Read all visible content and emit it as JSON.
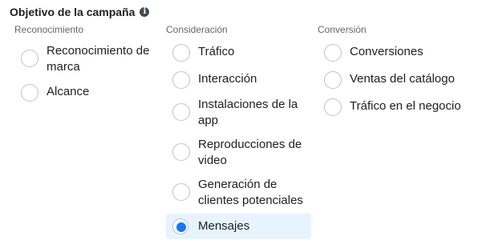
{
  "title": "Objetivo de la campaña",
  "info_icon_glyph": "i",
  "columns": [
    {
      "header": "Reconocimiento",
      "options": [
        {
          "label_line1": "Reconocimiento de",
          "label_line2": "marca"
        },
        {
          "label_line1": "Alcance",
          "label_line2": ""
        }
      ]
    },
    {
      "header": "Consideración",
      "options": [
        {
          "label_line1": "Tráfico",
          "label_line2": ""
        },
        {
          "label_line1": "Interacción",
          "label_line2": ""
        },
        {
          "label_line1": "Instalaciones de la",
          "label_line2": "app"
        },
        {
          "label_line1": "Reproducciones de",
          "label_line2": "video"
        },
        {
          "label_line1": "Generación de",
          "label_line2": "clientes potenciales"
        },
        {
          "label_line1": "Mensajes",
          "label_line2": "",
          "selected": true
        }
      ]
    },
    {
      "header": "Conversión",
      "options": [
        {
          "label_line1": "Conversiones",
          "label_line2": ""
        },
        {
          "label_line1": "Ventas del catálogo",
          "label_line2": ""
        },
        {
          "label_line1": "Tráfico en el negocio",
          "label_line2": ""
        }
      ]
    }
  ],
  "colors": {
    "accent": "#1877f2",
    "selected_bg": "#e7f3ff",
    "radio_border": "#bec3c9"
  }
}
